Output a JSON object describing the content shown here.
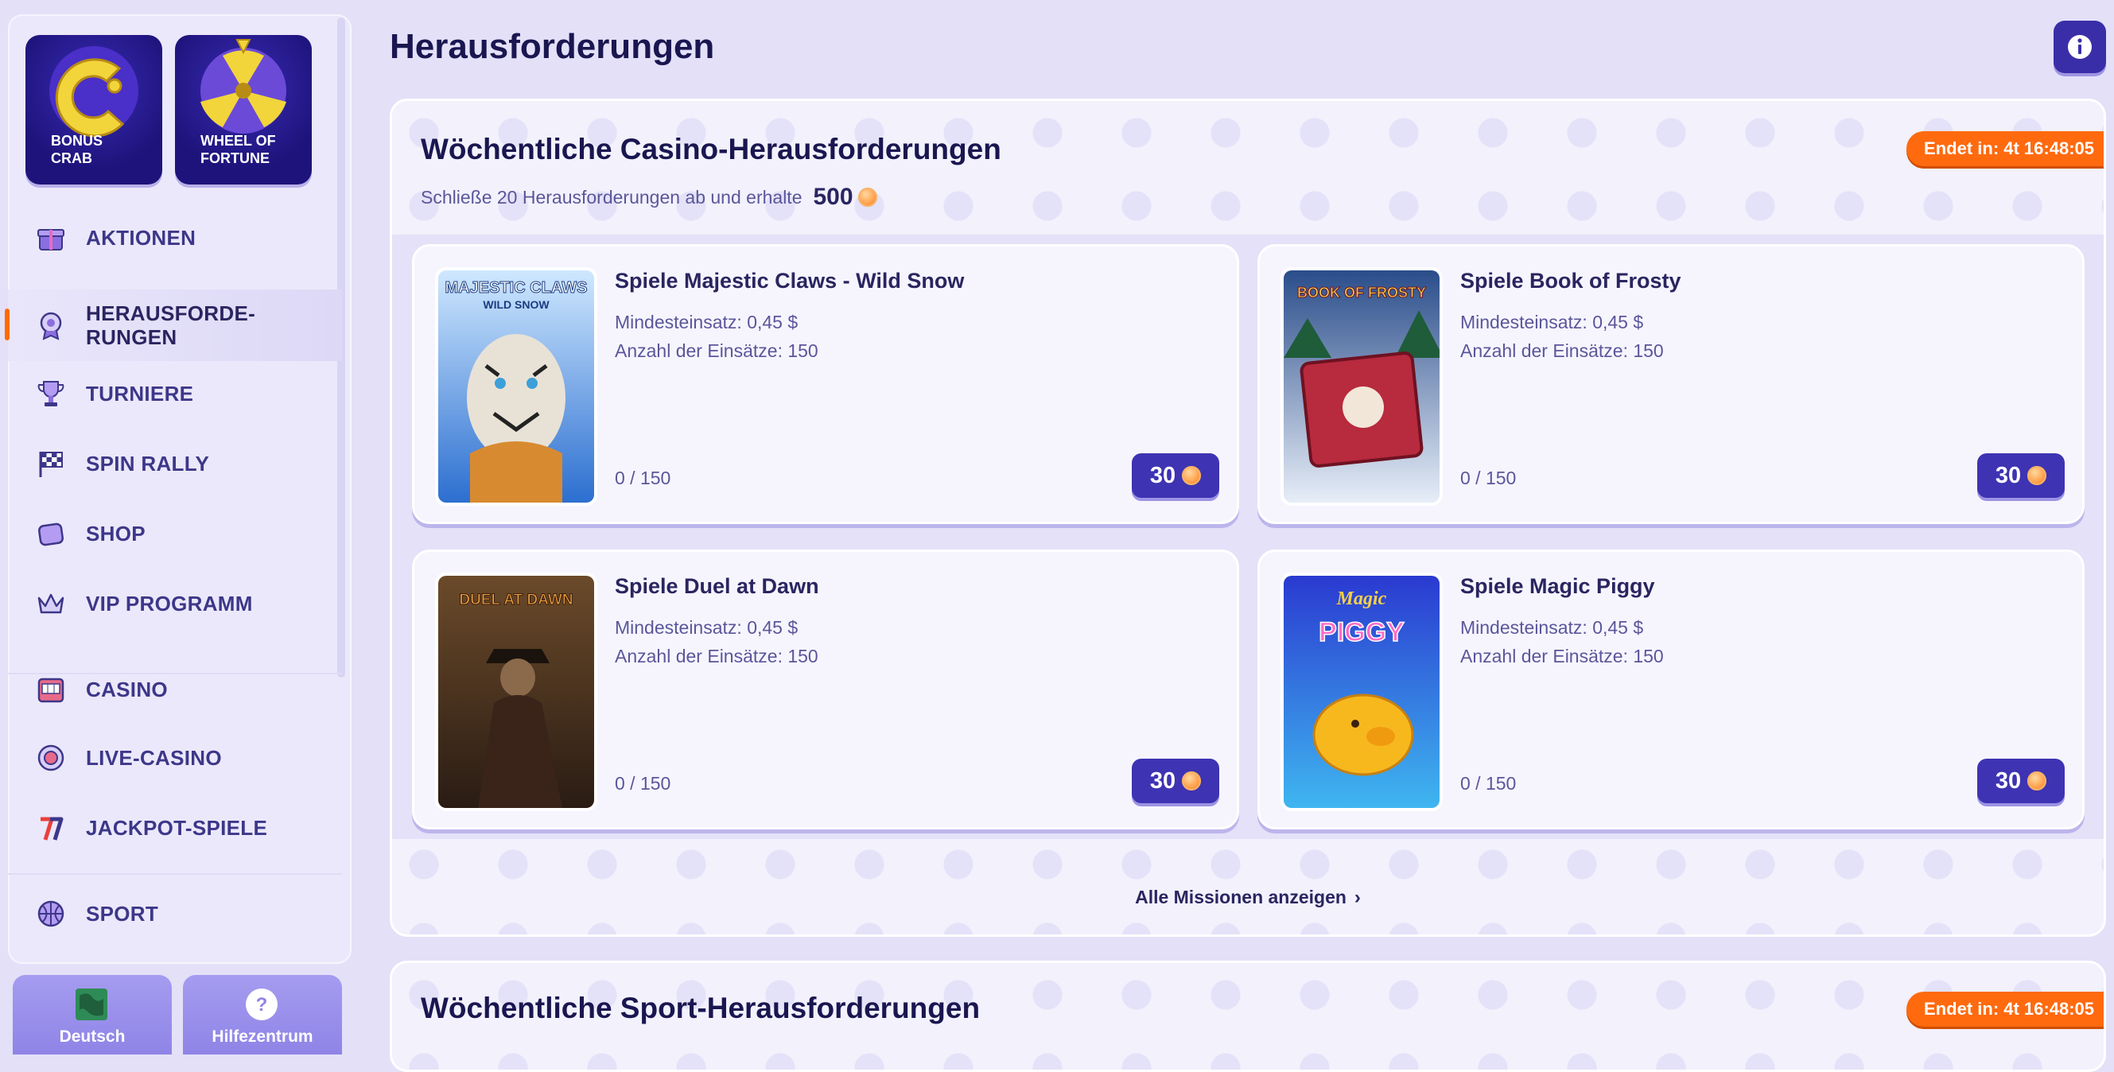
{
  "sidebar": {
    "promos": [
      {
        "label": "BONUS\nCRAB",
        "icon": "bonus-crab-icon"
      },
      {
        "label": "WHEEL OF\nFORTUNE",
        "icon": "wheel-of-fortune-icon"
      }
    ],
    "items": [
      {
        "label": "AKTIONEN",
        "icon": "gift-icon"
      },
      {
        "label": "HERAUSFORDE-\nRUNGEN",
        "icon": "badge-icon",
        "active": true
      },
      {
        "label": "TURNIERE",
        "icon": "trophy-icon"
      },
      {
        "label": "SPIN RALLY",
        "icon": "checkered-flag-icon"
      },
      {
        "label": "SHOP",
        "icon": "shop-icon"
      },
      {
        "label": "VIP PROGRAMM",
        "icon": "crown-icon"
      },
      {
        "label": "CASINO",
        "icon": "slot-machine-icon"
      },
      {
        "label": "LIVE-CASINO",
        "icon": "roulette-chip-icon"
      },
      {
        "label": "JACKPOT-SPIELE",
        "icon": "seven-icon"
      },
      {
        "label": "SPORT",
        "icon": "basketball-icon"
      }
    ],
    "bottom": [
      {
        "label": "Deutsch",
        "icon": "globe-icon"
      },
      {
        "label": "Hilfezentrum",
        "icon": "help-icon"
      }
    ]
  },
  "header": {
    "title": "Herausforderungen",
    "info_icon": "info-icon"
  },
  "casino": {
    "title": "Wöchentliche Casino-Herausforderungen",
    "ends": "Endet in: 4t 16:48:05",
    "subtitle": "Schließe 20 Herausforderungen ab und erhalte",
    "amount": "500",
    "all_missions": "Alle Missionen anzeigen",
    "challenges": [
      {
        "title": "Spiele Majestic Claws - Wild Snow",
        "min_bet": "Mindesteinsatz: 0,45 $",
        "count": "Anzahl der Einsätze: 150",
        "progress": "0 / 150",
        "reward": "30",
        "thumb_title": "MAJESTIC CLAWS",
        "thumb_sub": "WILD SNOW"
      },
      {
        "title": "Spiele Book of Frosty",
        "min_bet": "Mindesteinsatz: 0,45 $",
        "count": "Anzahl der Einsätze: 150",
        "progress": "0 / 150",
        "reward": "30",
        "thumb_title": "BOOK OF FROSTY",
        "thumb_sub": ""
      },
      {
        "title": "Spiele Duel at Dawn",
        "min_bet": "Mindesteinsatz: 0,45 $",
        "count": "Anzahl der Einsätze: 150",
        "progress": "0 / 150",
        "reward": "30",
        "thumb_title": "DUEL AT DAWN",
        "thumb_sub": ""
      },
      {
        "title": "Spiele Magic Piggy",
        "min_bet": "Mindesteinsatz: 0,45 $",
        "count": "Anzahl der Einsätze: 150",
        "progress": "0 / 150",
        "reward": "30",
        "thumb_title": "Magic",
        "thumb_sub": "PIGGY"
      }
    ]
  },
  "sport": {
    "title": "Wöchentliche Sport-Herausforderungen",
    "ends": "Endet in: 4t 16:48:05"
  },
  "colors": {
    "accent": "#3e33b2",
    "badge": "#ff6a0f",
    "active_bar": "#ff6a00"
  }
}
